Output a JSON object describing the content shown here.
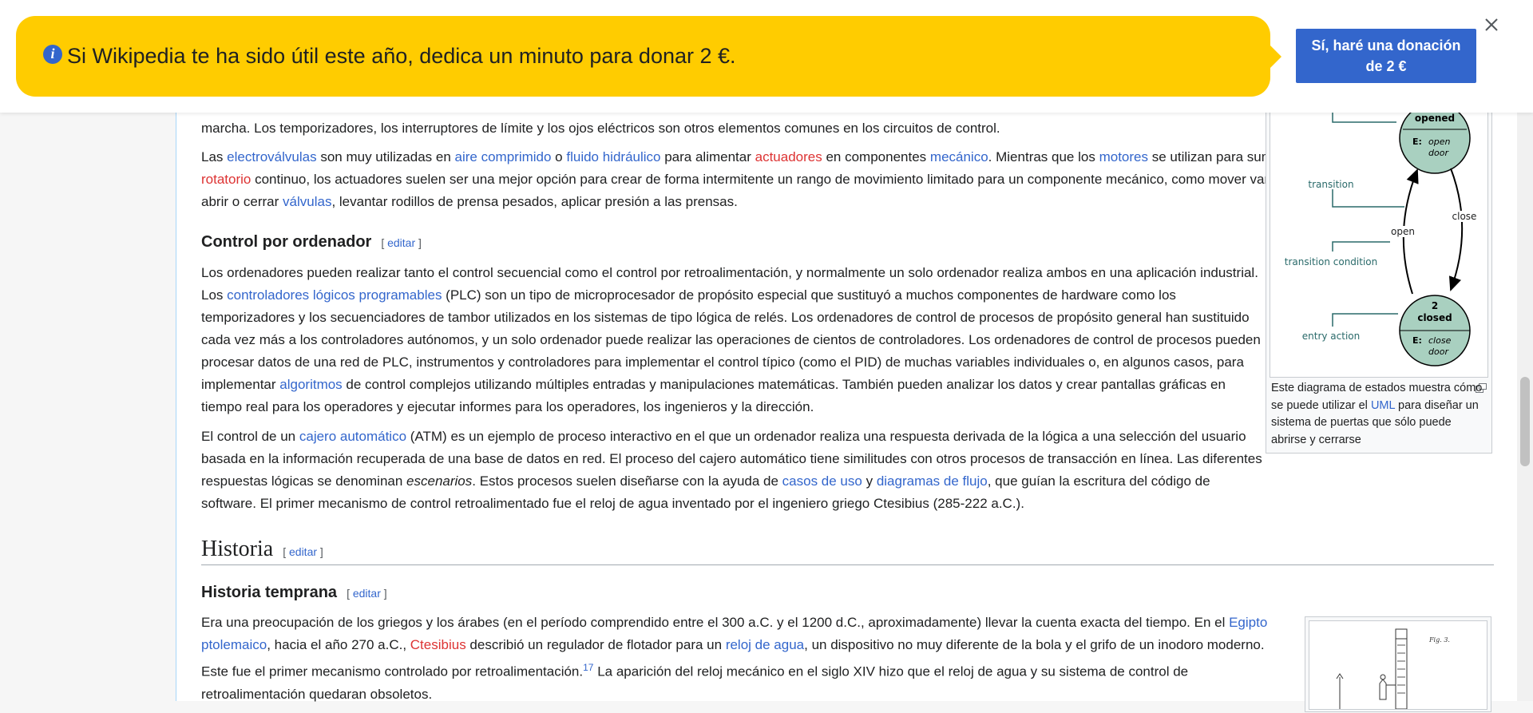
{
  "banner": {
    "message": "Si Wikipedia te ha sido útil este año, dedica un minuto para donar 2 €.",
    "donate_label": "Sí, haré una donación de 2 €",
    "info_icon": "i",
    "accent": "#ffcc00",
    "button_color": "#3366cc"
  },
  "paragraphs": {
    "p0_tail": "marcha. Los temporizadores, los interruptores de límite y los ojos eléctricos son otros elementos comunes en los circuitos de control.",
    "p1": {
      "t1": "Las ",
      "l_electrovalvulas": "electroválvulas",
      "t2": " son muy utilizadas en ",
      "l_aire": "aire comprimido",
      "t3": " o ",
      "l_fluido": "fluido hidráulico",
      "t4": " para alimentar ",
      "l_actuadores": "actuadores",
      "t5": " en componentes ",
      "l_mecanico": "mecánico",
      "t6": ". Mientras que los ",
      "l_motores": "motores",
      "t7": " se utilizan para suministrar un ",
      "l_movimiento": "movimiento rotatorio",
      "t8": " continuo, los actuadores suelen ser una mejor opción para crear de forma intermitente un rango de movimiento limitado para un componente mecánico, como mover varios brazos mecánicos, abrir o cerrar ",
      "l_valvulas": "válvulas",
      "t9": ", levantar rodillos de prensa pesados, aplicar presión a las prensas."
    },
    "h3_control": "Control por ordenador",
    "edit_word": "editar",
    "p2": {
      "t1": "Los ordenadores pueden realizar tanto el control secuencial como el control por retroalimentación, y normalmente un solo ordenador realiza ambos en una aplicación industrial. Los ",
      "l_plc": "controladores lógicos programables",
      "t2": " (PLC) son un tipo de microprocesador de propósito especial que sustituyó a muchos componentes de hardware como los temporizadores y los secuenciadores de tambor utilizados en los sistemas de tipo lógica de relés. Los ordenadores de control de procesos de propósito general han sustituido cada vez más a los controladores autónomos, y un solo ordenador puede realizar las operaciones de cientos de controladores. Los ordenadores de control de procesos pueden procesar datos de una red de PLC, instrumentos y controladores para implementar el control típico (como el PID) de muchas variables individuales o, en algunos casos, para implementar ",
      "l_algoritmos": "algoritmos",
      "t3": " de control complejos utilizando múltiples entradas y manipulaciones matemáticas. También pueden analizar los datos y crear pantallas gráficas en tiempo real para los operadores y ejecutar informes para los operadores, los ingenieros y la dirección."
    },
    "p3": {
      "t1": "El control de un ",
      "l_cajero": "cajero automático",
      "t2": " (ATM) es un ejemplo de proceso interactivo en el que un ordenador realiza una respuesta derivada de la lógica a una selección del usuario basada en la información recuperada de una base de datos en red. El proceso del cajero automático tiene similitudes con otros procesos de transacción en línea. Las diferentes respuestas lógicas se denominan ",
      "em": "escenarios",
      "t3": ". Estos procesos suelen diseñarse con la ayuda de ",
      "l_casos": "casos de uso",
      "t4": " y ",
      "l_diagramas": "diagramas de flujo",
      "t5": ", que guían la escritura del código de software. El primer mecanismo de control retroalimentado fue el reloj de agua inventado por el ingeniero griego Ctesibius (285-222 a.C.)."
    },
    "h2_historia": "Historia",
    "h3_temprana": "Historia temprana",
    "p4": {
      "t1": "Era una preocupación de los griegos y los árabes (en el período comprendido entre el 300 a.C. y el 1200 d.C., aproximadamente) llevar la cuenta exacta del tiempo. En el ",
      "l_egipto": "Egipto ptolemaico",
      "t2": ", hacia el año 270 a.C., ",
      "l_ctesibius": "Ctesibius",
      "t3": " describió un regulador de flotador para un ",
      "l_reloj": "reloj de agua",
      "t4": ", un dispositivo no muy diferente de la bola y el grifo de un inodoro moderno. Este fue el primer mecanismo controlado por retroalimentación.",
      "ref": "17",
      "t5": " La aparición del reloj mecánico en el siglo XIV hizo que el reloj de agua y su sistema de control de retroalimentación quedaran obsoletos."
    }
  },
  "diagram": {
    "state1_name": "opened",
    "state1_action_label": "E:",
    "state1_action_a": "open",
    "state1_action_b": "door",
    "state2_number": "2",
    "state2_name": "closed",
    "state2_action_label": "E:",
    "state2_action_a": "close",
    "state2_action_b": "door",
    "transition": "transition",
    "transition_condition": "transition condition",
    "entry_action": "entry action",
    "open": "open",
    "close": "close",
    "fig_label": "Fig. 3."
  },
  "caption": {
    "t1": "Este diagrama de estados muestra cómo se puede utilizar el ",
    "l_uml": "UML",
    "t2": " para diseñar un sistema de puertas que sólo puede abrirse y cerrarse"
  }
}
